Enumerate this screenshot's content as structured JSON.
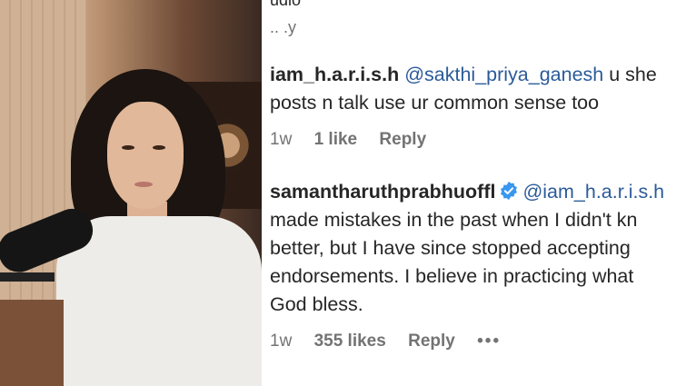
{
  "photo": {
    "alt": "person"
  },
  "top_partial": {
    "text1": "udio",
    "text2": "..  .y"
  },
  "comments": [
    {
      "username": "iam_h.a.r.i.s.h",
      "mention": "@sakthi_priya_ganesh",
      "line1_rest": "u she",
      "line2": "posts n talk use ur common sense too",
      "time": "1w",
      "likes": "1 like",
      "reply": "Reply"
    },
    {
      "username": "samantharuthprabhuoffl",
      "verified": true,
      "mention": "@iam_h.a.r.i.s.h",
      "line2": "made mistakes in the past when I didn't kn",
      "line3": "better, but I have since stopped accepting",
      "line4": "endorsements. I believe in practicing what",
      "line5": "God bless.",
      "time": "1w",
      "likes": "355 likes",
      "reply": "Reply",
      "more": "•••"
    }
  ],
  "bottom_partial": "...   ..",
  "colors": {
    "text": "#262626",
    "muted": "#737373",
    "mention": "#2b5b99",
    "verified": "#3897f0"
  }
}
